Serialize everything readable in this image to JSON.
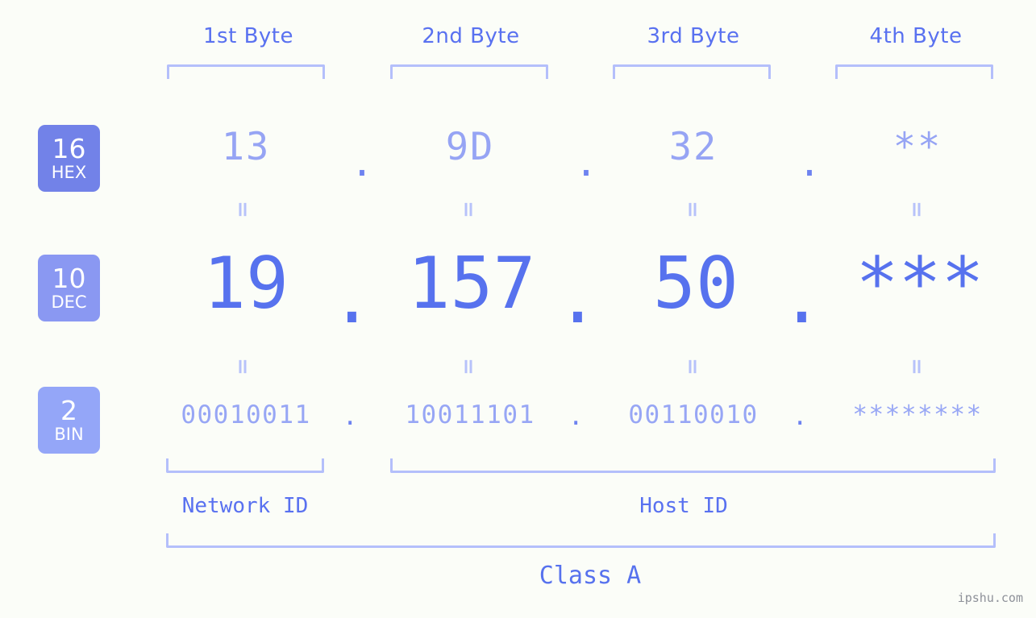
{
  "header": {
    "byte_labels": [
      "1st Byte",
      "2nd Byte",
      "3rd Byte",
      "4th Byte"
    ]
  },
  "bases": [
    {
      "number": "16",
      "abbr": "HEX"
    },
    {
      "number": "10",
      "abbr": "DEC"
    },
    {
      "number": "2",
      "abbr": "BIN"
    }
  ],
  "rows": {
    "hex": {
      "values": [
        "13",
        "9D",
        "32",
        "**"
      ],
      "separator": "."
    },
    "dec": {
      "values": [
        "19",
        "157",
        "50",
        "***"
      ],
      "separator": "."
    },
    "bin": {
      "values": [
        "00010011",
        "10011101",
        "00110010",
        "********"
      ],
      "separator": "."
    }
  },
  "equals_marker": "=",
  "footer": {
    "network_id_label": "Network ID",
    "host_id_label": "Host ID",
    "class_label": "Class A"
  },
  "watermark": "ipshu.com",
  "colors": {
    "background": "#fbfdf8",
    "accent_strong": "#5772ee",
    "accent_mid": "#7282e8",
    "accent_light": "#96a4f4",
    "bracket": "#b4bffb",
    "badge_hex": "#7282e8",
    "badge_dec": "#8a98f2",
    "badge_bin": "#94a6f8",
    "watermark": "#8e9199"
  }
}
